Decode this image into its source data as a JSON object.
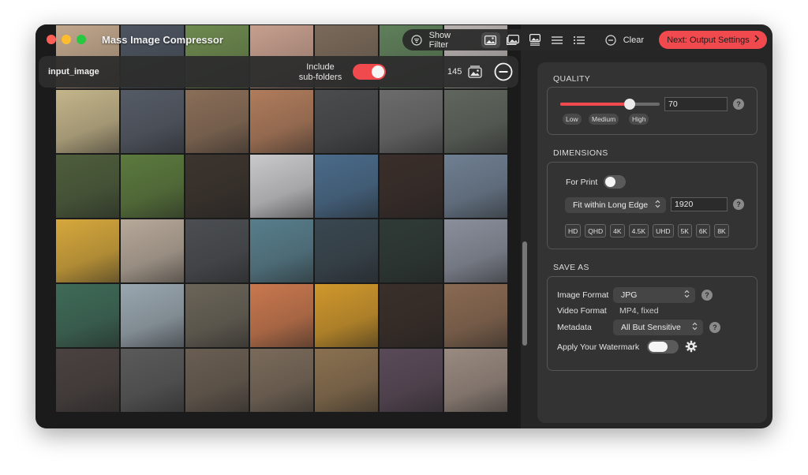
{
  "app": {
    "title": "Mass Image Compressor"
  },
  "toolbar": {
    "show_filter": "Show Filter",
    "clear": "Clear",
    "next": "Next: Output Settings"
  },
  "input_bar": {
    "folder": "input_image",
    "include_label": "Include sub-folders",
    "include_on": true,
    "count": "145"
  },
  "quality": {
    "section": "QUALITY",
    "value": "70",
    "level": 0.7,
    "presets": [
      "Low",
      "Medium",
      "High"
    ]
  },
  "dimensions": {
    "section": "DIMENSIONS",
    "for_print": "For Print",
    "for_print_on": false,
    "mode": "Fit within Long Edge",
    "value": "1920",
    "resolutions": [
      "HD",
      "QHD",
      "4K",
      "4.5K",
      "UHD",
      "5K",
      "6K",
      "8K"
    ]
  },
  "save_as": {
    "section": "SAVE AS",
    "image_format_label": "Image Format",
    "image_format": "JPG",
    "video_format_label": "Video Format",
    "video_format": "MP4, fixed",
    "metadata_label": "Metadata",
    "metadata": "All But Sensitive",
    "watermark_label": "Apply Your Watermark",
    "watermark_on": false
  },
  "help_glyph": "?",
  "colors": {
    "accent": "#f04a4f",
    "panel": "#333333",
    "window": "#262626"
  },
  "icons": [
    "filter-icon",
    "image-icon",
    "images-icon",
    "image-detail-icon",
    "list-icon",
    "list-bullet-icon",
    "minus-circle-icon",
    "chevron-right-icon",
    "photo-stack-icon",
    "gear-icon"
  ]
}
